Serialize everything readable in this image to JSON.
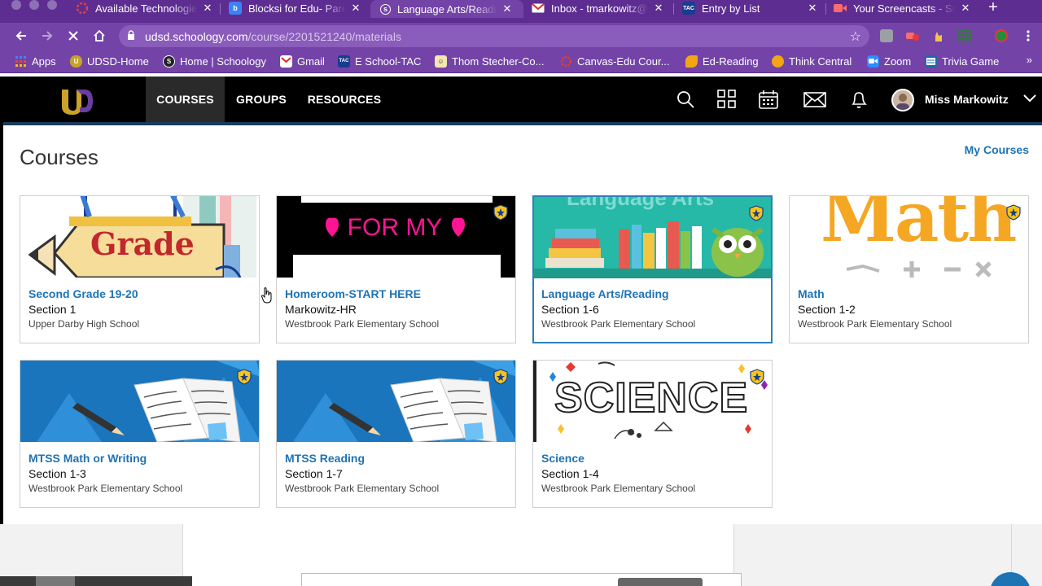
{
  "browser": {
    "tabs": [
      {
        "title": "Available Technologies",
        "icon": "red-circle-icon",
        "active": false
      },
      {
        "title": "Blocksi for Edu- Parent",
        "icon": "blocksi-icon",
        "active": false
      },
      {
        "title": "Language Arts/Reading",
        "icon": "schoology-icon",
        "active": true
      },
      {
        "title": "Inbox - tmarkowitz@u",
        "icon": "gmail-icon",
        "active": false
      },
      {
        "title": "Entry by List",
        "icon": "tac-icon",
        "active": false
      },
      {
        "title": "Your Screencasts - Sc",
        "icon": "screencastify-icon",
        "active": false
      }
    ],
    "url_domain": "udsd.schoology.com",
    "url_path": "/course/2201521240/materials",
    "bookmarks": [
      {
        "label": "Apps",
        "icon": "apps-grid-icon",
        "color": "#4285f4"
      },
      {
        "label": "UDSD-Home",
        "icon": "udsd-icon",
        "color": "#c9a227"
      },
      {
        "label": "Home | Schoology",
        "icon": "schoology-icon",
        "color": "#222"
      },
      {
        "label": "Gmail",
        "icon": "gmail-icon",
        "color": "#d93025"
      },
      {
        "label": "E School-TAC",
        "icon": "tac-icon",
        "color": "#1a3c8f"
      },
      {
        "label": "Thom Stecher-Co...",
        "icon": "comic-icon",
        "color": "#ccb14a"
      },
      {
        "label": "Canvas-Edu Cour...",
        "icon": "canvas-icon",
        "color": "#e13f2b"
      },
      {
        "label": "Ed-Reading",
        "icon": "ed-reading-icon",
        "color": "#f2a516"
      },
      {
        "label": "Think Central",
        "icon": "think-central-icon",
        "color": "#f2a516"
      },
      {
        "label": "Zoom",
        "icon": "zoom-icon",
        "color": "#2d8cff"
      },
      {
        "label": "Trivia Game",
        "icon": "trivia-icon",
        "color": "#1a6aa8"
      }
    ]
  },
  "header": {
    "nav": [
      "COURSES",
      "GROUPS",
      "RESOURCES"
    ],
    "user_name": "Miss Markowitz"
  },
  "page": {
    "title": "Courses",
    "my_courses_link": "My Courses"
  },
  "courses": [
    {
      "name": "Second Grade 19-20",
      "section": "Section 1",
      "school": "Upper Darby High School",
      "image": "grade-pencil"
    },
    {
      "name": "Homeroom-START HERE",
      "section": "Markowitz-HR",
      "school": "Westbrook Park Elementary School",
      "image": "for-my-students",
      "image_text": "FOR MY"
    },
    {
      "name": "Language Arts/Reading",
      "section": "Section 1-6",
      "school": "Westbrook Park Elementary School",
      "image": "language-arts-books",
      "image_text": "Language Arts"
    },
    {
      "name": "Math",
      "section": "Section 1-2",
      "school": "Westbrook Park Elementary School",
      "image": "math-letters",
      "image_text": "Math"
    },
    {
      "name": "MTSS Math or Writing",
      "section": "Section 1-3",
      "school": "Westbrook Park Elementary School",
      "image": "open-book-pencil"
    },
    {
      "name": "MTSS Reading",
      "section": "Section 1-7",
      "school": "Westbrook Park Elementary School",
      "image": "open-book-pencil"
    },
    {
      "name": "Science",
      "section": "Section 1-4",
      "school": "Westbrook Park Elementary School",
      "image": "science-doodle",
      "image_text": "SCIENCE"
    }
  ],
  "colors": {
    "browser_purple": "#7343a8",
    "link_blue": "#1e73b4",
    "header_black": "#000000"
  }
}
